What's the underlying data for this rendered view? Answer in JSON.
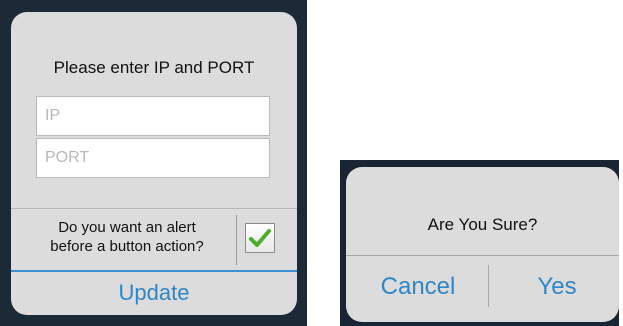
{
  "connect_dialog": {
    "title": "Please enter IP and PORT",
    "ip_field": {
      "placeholder": "IP",
      "value": ""
    },
    "port_field": {
      "placeholder": "PORT",
      "value": ""
    },
    "alert_option": {
      "line1": "Do you want an alert",
      "line2": "before a button action?",
      "checked": true
    },
    "update_label": "Update"
  },
  "confirm_dialog": {
    "question": "Are You Sure?",
    "cancel_label": "Cancel",
    "yes_label": "Yes"
  },
  "colors": {
    "accent": "#2f86c9",
    "dialog_bg": "#dcdcdc",
    "backdrop": "#1c2a38",
    "check_green": "#4caf2c"
  }
}
